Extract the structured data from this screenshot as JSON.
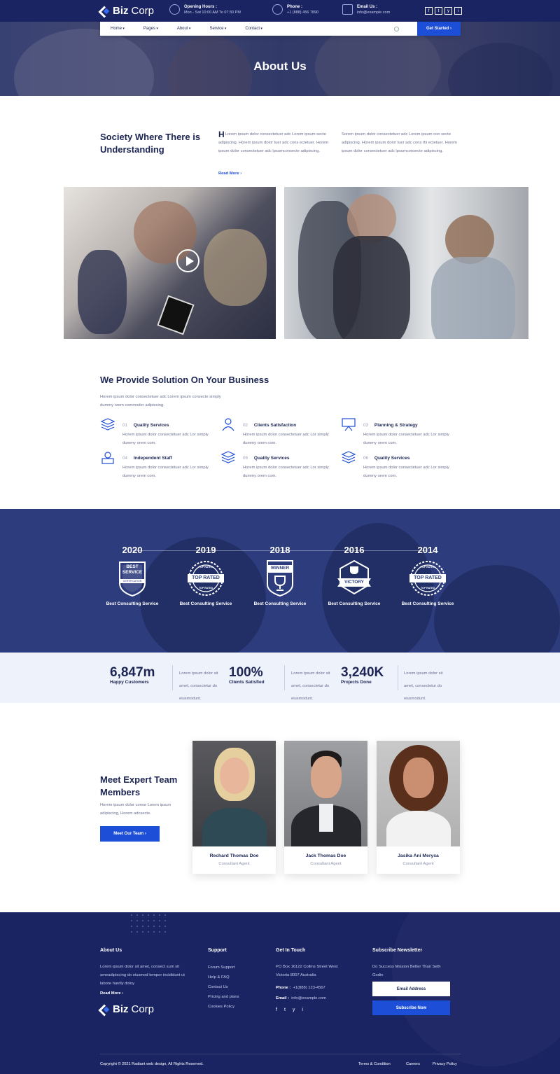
{
  "brand": {
    "name_bold": "Biz",
    "name_light": "Corp"
  },
  "topbar": {
    "hours": {
      "title": "Opening Hours :",
      "value": "Mon - Sat 10:00 AM To 07:30 PM"
    },
    "phone": {
      "title": "Phone :",
      "value": "+1 (888) 456 7890"
    },
    "email": {
      "title": "Email Us :",
      "value": "info@example.com"
    },
    "social": [
      "f",
      "t",
      "y",
      "i"
    ]
  },
  "nav": {
    "items": [
      "Home",
      "Pages",
      "About",
      "Service",
      "Contact"
    ],
    "cta": "Get Started ›"
  },
  "hero": {
    "title": "About Us"
  },
  "about": {
    "heading": "Society Where There is Understanding",
    "col1": "Lorem ipsum dolor consectetuer adc Lorem ipsum secte adipiscing. Horem ipsum dolor tuer adc cons ectetuer. Horem ipsum dolor consectetuer adc ipsumconsecte adipiscing.",
    "col1_dropcap": "H",
    "col2": "Sorem ipsum dolor consectetuer adc Lorem ipsum con secte adipiscing. Horem ipsum dolor tuer adc cons thi ectetuer. Horem ipsum dolor consectetuer adc ipsumconsecte adipiscing.",
    "read_more": "Read More ›"
  },
  "solutions": {
    "heading": "We Provide Solution On Your Business",
    "desc": "Horem ipsum dolor consectetuer adc Lorem ipsum consecte simply dummy orem commoder adipiscing.",
    "items": [
      {
        "num": "01",
        "title": "Quality Services",
        "desc": "Horem ipsum dolor consectetuer adc Lor simply dummy orem com.",
        "icon": "layers-icon"
      },
      {
        "num": "02",
        "title": "Clients Satisfaction",
        "desc": "Horem ipsum dolor consectetuer adc Lor simply dummy orem com.",
        "icon": "user-icon"
      },
      {
        "num": "03",
        "title": "Planning & Strategy",
        "desc": "Horem ipsum dolor consectetuer adc Lor simply dummy orem com.",
        "icon": "presentation-icon"
      },
      {
        "num": "04",
        "title": "Independent Staff",
        "desc": "Horem ipsum dolor consectetuer adc Lor simply dummy orem com.",
        "icon": "staff-icon"
      },
      {
        "num": "05",
        "title": "Quality Services",
        "desc": "Horem ipsum dolor consectetuer adc Lor simply dummy orem com.",
        "icon": "layers-icon"
      },
      {
        "num": "06",
        "title": "Quality Services",
        "desc": "Horem ipsum dolor consectetuer adc Lor simply dummy orem com.",
        "icon": "layers-icon"
      }
    ]
  },
  "awards": [
    {
      "year": "2020",
      "badge_top": "BEST",
      "badge_mid": "SERVICE",
      "badge_bot": "CERTIFICATION",
      "label": "Best Consulting Service"
    },
    {
      "year": "2019",
      "badge_top": "TOP RATED",
      "badge_mid": "TOP RATED",
      "badge_bot": "TOP RATED",
      "label": "Best Consulting Service"
    },
    {
      "year": "2018",
      "badge_top": "WINNER",
      "badge_mid": "",
      "badge_bot": "",
      "label": "Best Consulting Service"
    },
    {
      "year": "2016",
      "badge_top": "",
      "badge_mid": "VICTORY",
      "badge_bot": "",
      "label": "Best Consulting Service"
    },
    {
      "year": "2014",
      "badge_top": "TOP RATED",
      "badge_mid": "TOP RATED",
      "badge_bot": "TOP RATED",
      "label": "Best Consulting Service"
    }
  ],
  "stats": [
    {
      "num": "6,847m",
      "label": "Happy Customers",
      "desc": "Lorem ipsum dolor sit amet, consectetur do eiusmodunt."
    },
    {
      "num": "100%",
      "label": "Clients Satisfied",
      "desc": "Lorem ipsum dolor sit amet, consectetur do eiusmodunt."
    },
    {
      "num": "3,240K",
      "label": "Projects Done",
      "desc": "Lorem ipsum dolor sit amet, consectetur do eiusmodunt."
    }
  ],
  "team": {
    "heading": "Meet Expert Team Members",
    "desc": "Horem ipsum dolor conse Lorem ipsum adipiscing, Horem adcsecte.",
    "button": "Meet Our Team ›",
    "members": [
      {
        "name": "Rechard Thomas Doe",
        "role": "Consultant Agent"
      },
      {
        "name": "Jack Thomas Doe",
        "role": "Consultant Agent"
      },
      {
        "name": "Jasika Ani Merysa",
        "role": "Consultant Agent"
      }
    ]
  },
  "footer": {
    "about": {
      "heading": "About Us",
      "text": "Lorem ipsum dolor sit amet, consect sum sit ameadipiscing do eiusmod tempor incididunt ut labore hardly doloy",
      "read_more": "Read More ›"
    },
    "support": {
      "heading": "Support",
      "links": [
        "Forum Support",
        "Help & FAQ",
        "Contact Us",
        "Pricing and plans",
        "Cookies Policy"
      ]
    },
    "contact": {
      "heading": "Get In Touch",
      "address": "PO Box 16122 Collins Street West Victoria 8007 Australia",
      "phone_label": "Phone :",
      "phone": "+1(888) 123-4567",
      "email_label": "Email :",
      "email": "info@example.com"
    },
    "newsletter": {
      "heading": "Subscribe Newsletter",
      "text": "Do Success Mission Better Than Seth Godin",
      "placeholder": "Email Address",
      "button": "Subscribe Now"
    },
    "copyright": "Copyright © 2021 Radiant web design, All Rights Reserved.",
    "bottom_links": [
      "Terms & Condition",
      "Careers",
      "Privacy Policy"
    ]
  }
}
